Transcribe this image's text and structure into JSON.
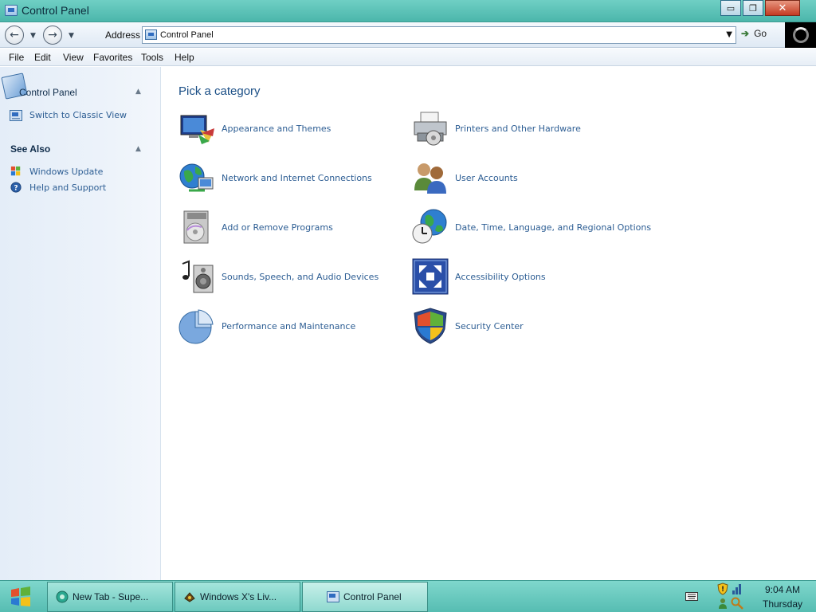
{
  "window": {
    "title": "Control Panel",
    "buttons": {
      "minimize": "▭",
      "restore": "❐",
      "close": "✕"
    }
  },
  "navbar": {
    "back_icon": "back-arrow-icon",
    "forward_icon": "forward-arrow-icon",
    "address_label": "Address",
    "address_value": "Control Panel",
    "go_label": "Go"
  },
  "menu": [
    "File",
    "Edit",
    "View",
    "Favorites",
    "Tools",
    "Help"
  ],
  "sidebar": {
    "panel_title": "Control Panel",
    "panel_links": [
      {
        "label": "Switch to Classic View",
        "icon": "control-panel-icon"
      }
    ],
    "see_also_title": "See Also",
    "see_also_links": [
      {
        "label": "Windows Update",
        "icon": "windows-update-icon"
      },
      {
        "label": "Help and Support",
        "icon": "help-icon"
      }
    ]
  },
  "main": {
    "heading": "Pick a category",
    "categories": [
      {
        "label": "Appearance and Themes",
        "icon": "appearance-themes-icon"
      },
      {
        "label": "Printers and Other Hardware",
        "icon": "printer-icon"
      },
      {
        "label": "Network and Internet Connections",
        "icon": "network-icon"
      },
      {
        "label": "User Accounts",
        "icon": "user-accounts-icon"
      },
      {
        "label": "Add or Remove Programs",
        "icon": "add-remove-programs-icon"
      },
      {
        "label": "Date, Time, Language, and Regional Options",
        "icon": "date-time-icon"
      },
      {
        "label": "Sounds, Speech, and Audio Devices",
        "icon": "sound-icon"
      },
      {
        "label": "Accessibility Options",
        "icon": "accessibility-icon"
      },
      {
        "label": "Performance and Maintenance",
        "icon": "performance-icon"
      },
      {
        "label": "Security Center",
        "icon": "security-shield-icon"
      }
    ]
  },
  "taskbar": {
    "tasks": [
      {
        "label": "New Tab - Supe...",
        "icon": "browser-icon",
        "active": false
      },
      {
        "label": "Windows X's Liv...",
        "icon": "app-icon",
        "active": false
      },
      {
        "label": "Control Panel",
        "icon": "control-panel-icon",
        "active": true
      }
    ],
    "clock_time": "9:04 AM",
    "clock_day": "Thursday"
  },
  "colors": {
    "title_bar": "#4bb6ab",
    "link": "#2c5d93",
    "heading": "#1b4f86",
    "sidebar_bg": "#e4edf8"
  }
}
